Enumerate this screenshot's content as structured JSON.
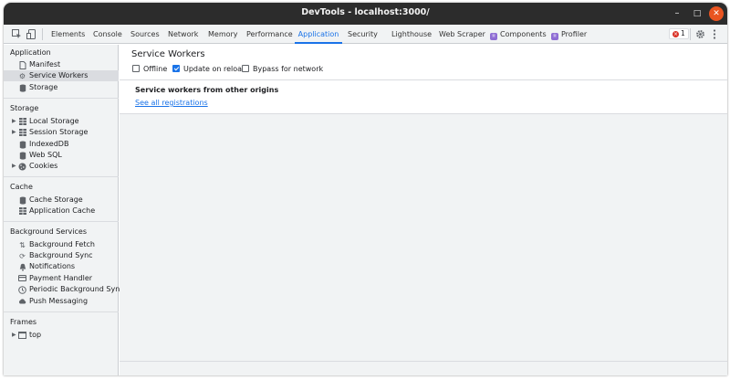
{
  "window": {
    "title": "DevTools - localhost:3000/",
    "minimize_glyph": "–",
    "maximize_glyph": "□",
    "close_glyph": "✕"
  },
  "toolbar": {
    "tabs": [
      {
        "label": "Elements"
      },
      {
        "label": "Console"
      },
      {
        "label": "Sources"
      },
      {
        "label": "Network"
      },
      {
        "label": "Memory"
      },
      {
        "label": "Performance"
      },
      {
        "label": "Application",
        "active": true
      },
      {
        "label": "Security"
      },
      {
        "label": "Lighthouse"
      },
      {
        "label": "Web Scraper"
      },
      {
        "label": "Components",
        "icon": "react-icon"
      },
      {
        "label": "Profiler",
        "icon": "react-icon"
      }
    ],
    "error_count": "1",
    "icons": [
      "inspect-element-icon",
      "device-toolbar-icon",
      "settings-gear-icon",
      "more-options-icon"
    ]
  },
  "sidebar": {
    "application": {
      "title": "Application",
      "items": [
        {
          "label": "Manifest",
          "icon": "document-icon"
        },
        {
          "label": "Service Workers",
          "icon": "gear-icon",
          "selected": true
        },
        {
          "label": "Storage",
          "icon": "database-icon"
        }
      ]
    },
    "storage": {
      "title": "Storage",
      "items": [
        {
          "label": "Local Storage",
          "icon": "grid-icon",
          "expandable": true
        },
        {
          "label": "Session Storage",
          "icon": "grid-icon",
          "expandable": true
        },
        {
          "label": "IndexedDB",
          "icon": "database-icon"
        },
        {
          "label": "Web SQL",
          "icon": "database-icon"
        },
        {
          "label": "Cookies",
          "icon": "cookie-icon",
          "expandable": true
        }
      ]
    },
    "cache": {
      "title": "Cache",
      "items": [
        {
          "label": "Cache Storage",
          "icon": "database-icon"
        },
        {
          "label": "Application Cache",
          "icon": "grid-icon"
        }
      ]
    },
    "background_services": {
      "title": "Background Services",
      "items": [
        {
          "label": "Background Fetch",
          "icon": "arrows-updown-icon"
        },
        {
          "label": "Background Sync",
          "icon": "sync-icon"
        },
        {
          "label": "Notifications",
          "icon": "bell-icon"
        },
        {
          "label": "Payment Handler",
          "icon": "card-icon"
        },
        {
          "label": "Periodic Background Sync",
          "icon": "clock-icon"
        },
        {
          "label": "Push Messaging",
          "icon": "cloud-icon"
        }
      ]
    },
    "frames": {
      "title": "Frames",
      "items": [
        {
          "label": "top",
          "icon": "frame-icon",
          "expandable": true
        }
      ]
    }
  },
  "main": {
    "title": "Service Workers",
    "options": [
      {
        "label": "Offline",
        "checked": false
      },
      {
        "label": "Update on reload",
        "checked": true
      },
      {
        "label": "Bypass for network",
        "checked": false
      }
    ],
    "other_origins_title": "Service workers from other origins",
    "see_all_link": "See all registrations"
  },
  "colors": {
    "accent": "#1a73e8",
    "titlebar": "#2c2c2c",
    "close_button": "#e95420",
    "panel_bg": "#f1f3f4",
    "selected_row": "#dadce0"
  }
}
